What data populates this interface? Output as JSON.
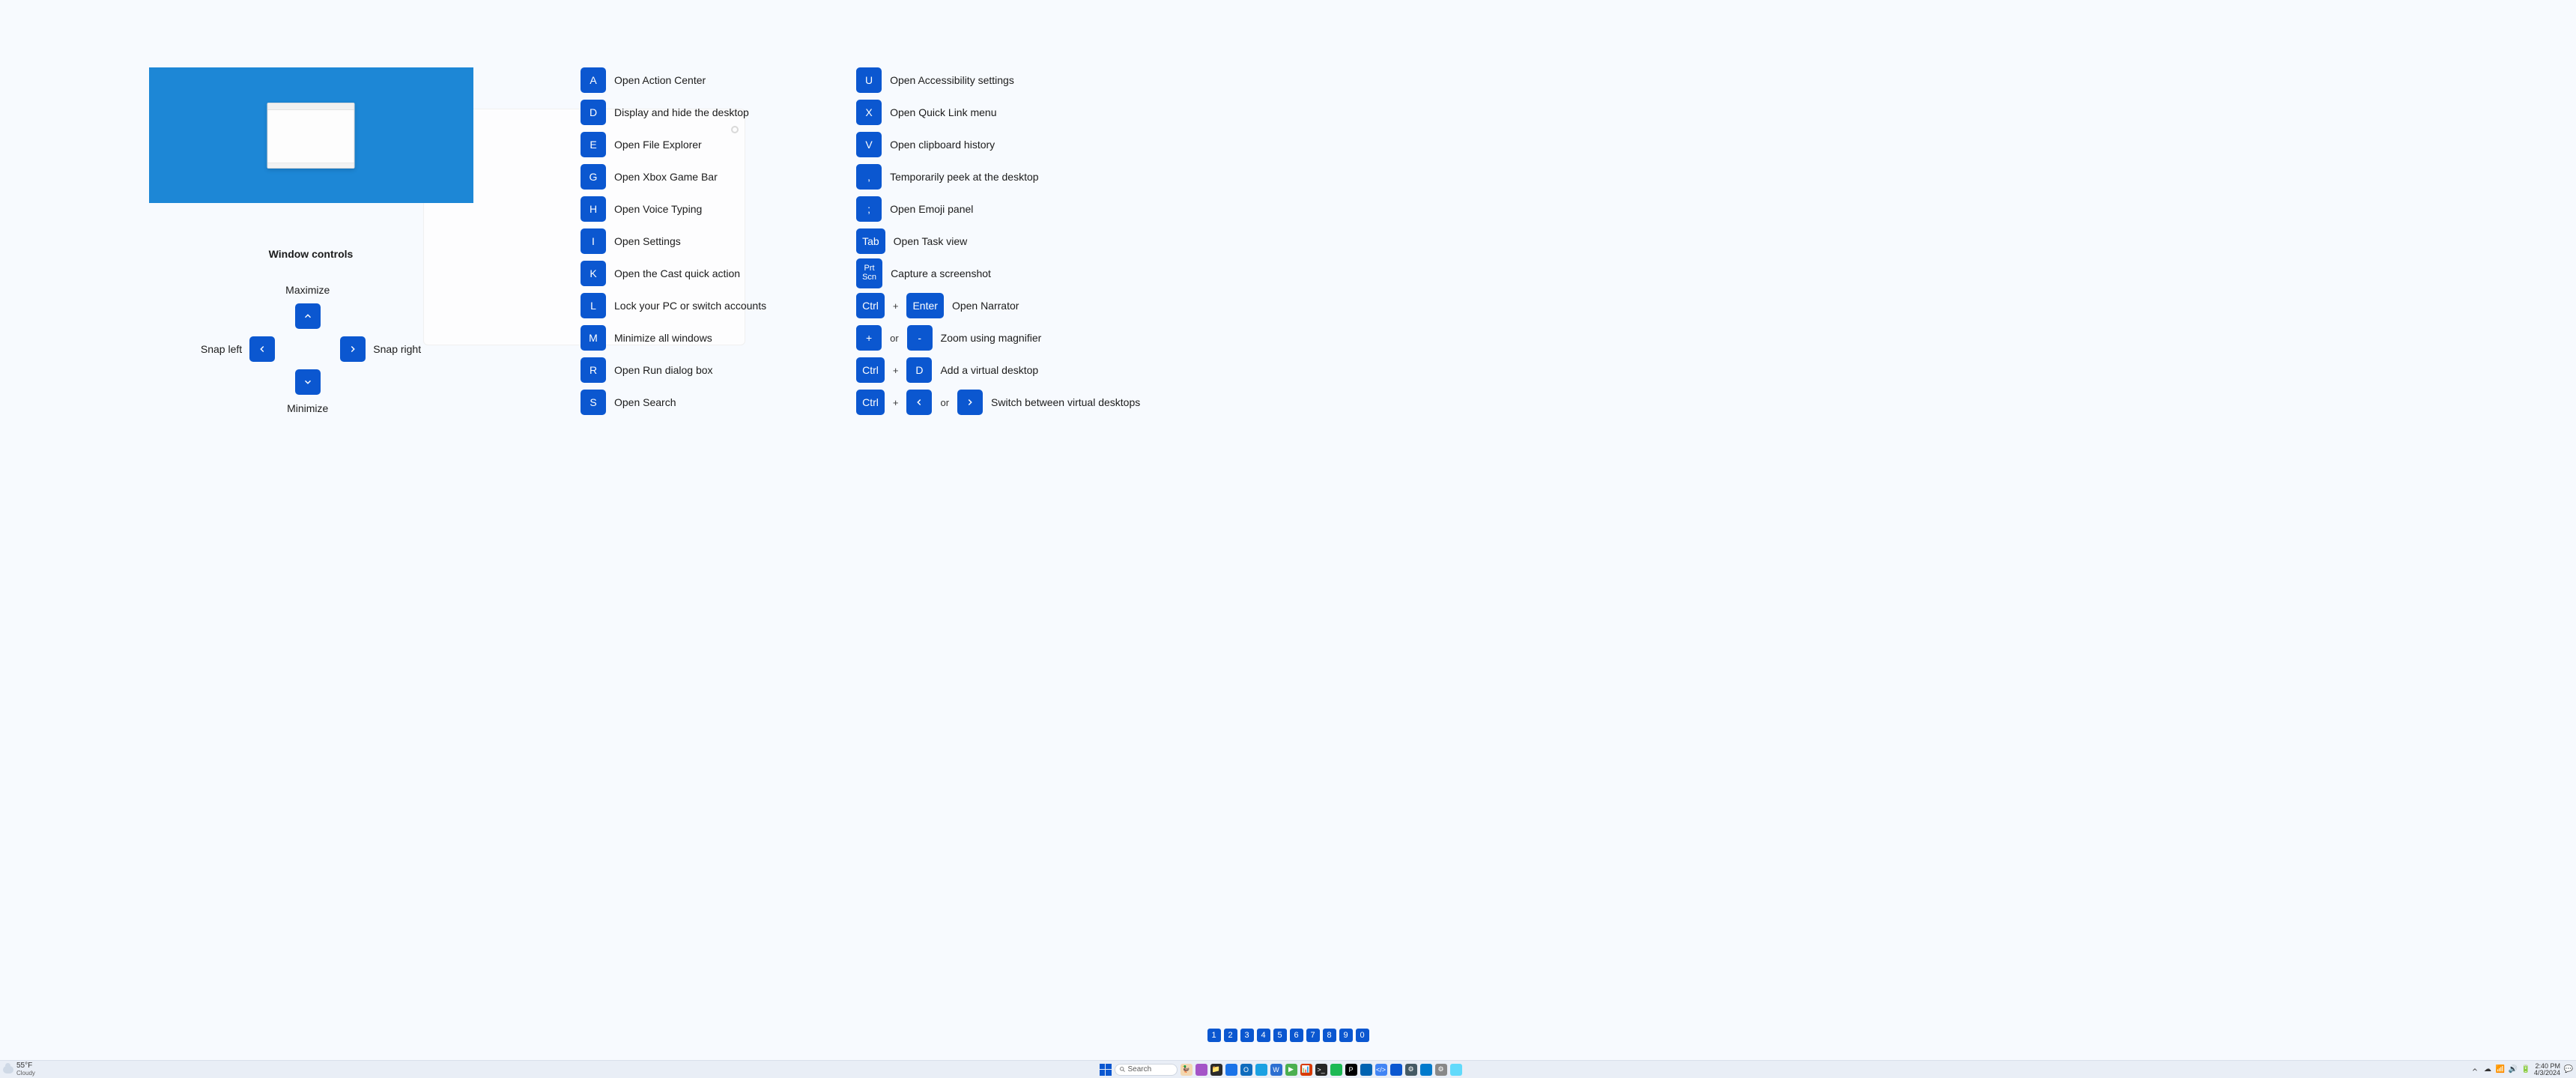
{
  "section_title": "Window controls",
  "window_controls": {
    "maximize": "Maximize",
    "minimize": "Minimize",
    "snap_left": "Snap left",
    "snap_right": "Snap right"
  },
  "shortcut_columns": [
    [
      {
        "keys": [
          {
            "label": "A"
          }
        ],
        "desc": "Open Action Center"
      },
      {
        "keys": [
          {
            "label": "D"
          }
        ],
        "desc": "Display and hide the desktop"
      },
      {
        "keys": [
          {
            "label": "E"
          }
        ],
        "desc": "Open File Explorer"
      },
      {
        "keys": [
          {
            "label": "G"
          }
        ],
        "desc": "Open Xbox Game Bar"
      },
      {
        "keys": [
          {
            "label": "H"
          }
        ],
        "desc": "Open Voice Typing"
      },
      {
        "keys": [
          {
            "label": "I"
          }
        ],
        "desc": "Open Settings"
      },
      {
        "keys": [
          {
            "label": "K"
          }
        ],
        "desc": "Open the Cast quick action"
      },
      {
        "keys": [
          {
            "label": "L"
          }
        ],
        "desc": "Lock your PC or switch accounts"
      },
      {
        "keys": [
          {
            "label": "M"
          }
        ],
        "desc": "Minimize all windows"
      },
      {
        "keys": [
          {
            "label": "R"
          }
        ],
        "desc": "Open Run dialog box"
      },
      {
        "keys": [
          {
            "label": "S"
          }
        ],
        "desc": "Open Search"
      }
    ],
    [
      {
        "keys": [
          {
            "label": "U"
          }
        ],
        "desc": "Open Accessibility settings"
      },
      {
        "keys": [
          {
            "label": "X"
          }
        ],
        "desc": "Open Quick Link menu"
      },
      {
        "keys": [
          {
            "label": "V"
          }
        ],
        "desc": "Open clipboard history"
      },
      {
        "keys": [
          {
            "label": ","
          }
        ],
        "desc": "Temporarily peek at the desktop"
      },
      {
        "keys": [
          {
            "label": ";"
          }
        ],
        "desc": "Open Emoji panel"
      },
      {
        "keys": [
          {
            "label": "Tab",
            "wide": true
          }
        ],
        "desc": "Open Task view"
      },
      {
        "keys": [
          {
            "label": "Prt Scn",
            "tall": true
          }
        ],
        "desc": "Capture a screenshot"
      },
      {
        "keys": [
          {
            "label": "Ctrl",
            "wide": true
          },
          {
            "sep": "+"
          },
          {
            "label": "Enter",
            "wide": true
          }
        ],
        "desc": "Open Narrator"
      },
      {
        "keys": [
          {
            "label": "+"
          },
          {
            "sep": "or"
          },
          {
            "label": "-"
          }
        ],
        "desc": "Zoom using magnifier"
      },
      {
        "keys": [
          {
            "label": "Ctrl",
            "wide": true
          },
          {
            "sep": "+"
          },
          {
            "label": "D"
          }
        ],
        "desc": "Add a virtual desktop"
      },
      {
        "keys": [
          {
            "label": "Ctrl",
            "wide": true
          },
          {
            "sep": "+"
          },
          {
            "icon": "left"
          },
          {
            "sep": "or"
          },
          {
            "icon": "right"
          }
        ],
        "desc": "Switch between virtual desktops"
      }
    ]
  ],
  "pager": [
    "1",
    "2",
    "3",
    "4",
    "5",
    "6",
    "7",
    "8",
    "9",
    "0"
  ],
  "taskbar": {
    "weather_temp": "55°F",
    "weather_desc": "Cloudy",
    "search_placeholder": "Search",
    "icons": [
      {
        "bg": "#f2d7b0",
        "char": "🦆",
        "name": "duck"
      },
      {
        "bg": "#a454c7",
        "char": "",
        "name": "clipchamp"
      },
      {
        "bg": "#2b2b2b",
        "char": "📁",
        "name": "explorer"
      },
      {
        "bg": "#1a73e8",
        "char": "",
        "name": "edge"
      },
      {
        "bg": "#0f6cbd",
        "char": "O",
        "name": "outlook"
      },
      {
        "bg": "#1ba1e2",
        "char": "",
        "name": "photos"
      },
      {
        "bg": "#2d6fd1",
        "char": "W",
        "name": "word"
      },
      {
        "bg": "#4caf50",
        "char": "▶",
        "name": "media"
      },
      {
        "bg": "#d83b01",
        "char": "📊",
        "name": "powerpoint"
      },
      {
        "bg": "#262626",
        "char": ">_",
        "name": "terminal"
      },
      {
        "bg": "#1db954",
        "char": "",
        "name": "spotify"
      },
      {
        "bg": "#000",
        "char": "P",
        "name": "publisher"
      },
      {
        "bg": "#0063b1",
        "char": "",
        "name": "store"
      },
      {
        "bg": "#4285f4",
        "char": "</>",
        "name": "devtools"
      },
      {
        "bg": "#0b57d0",
        "char": "",
        "name": "whiteboard"
      },
      {
        "bg": "#455a64",
        "char": "⚙",
        "name": "settings"
      },
      {
        "bg": "#007acc",
        "char": "",
        "name": "vscode"
      },
      {
        "bg": "#888",
        "char": "⚙",
        "name": "gear"
      },
      {
        "bg": "#61dafb",
        "char": "",
        "name": "react"
      }
    ],
    "clock_time": "2:40 PM",
    "clock_date": "4/3/2024"
  }
}
